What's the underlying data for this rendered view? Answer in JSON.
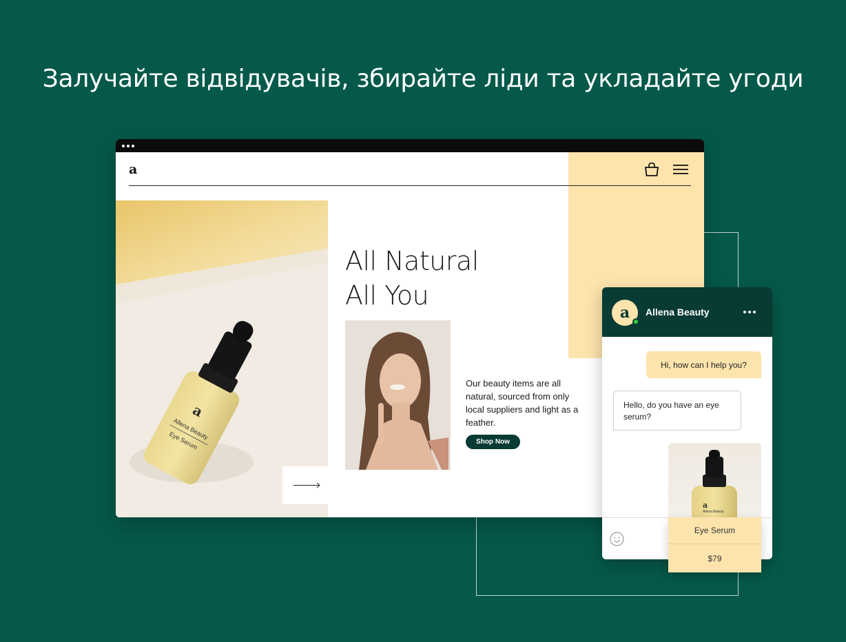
{
  "headline": "Залучайте відвідувачів, збирайте ліди та укладайте угоди",
  "colors": {
    "background": "#05594a",
    "accent_yellow": "#fde4ad",
    "dark_green": "#083b33",
    "online": "#2ecc40"
  },
  "site": {
    "logo": "a",
    "icons": [
      "cart-icon",
      "menu-icon",
      "arrow-right-icon"
    ],
    "hero": {
      "title_line1": "All Natural",
      "title_line2": "All You",
      "description": "Our beauty items are all natural, sourced from only local suppliers and light as a feather.",
      "cta": "Shop Now"
    },
    "product_label": {
      "logo": "a",
      "brand": "Allena Beauty",
      "name": "Eye Serum"
    }
  },
  "chat": {
    "avatar_letter": "a",
    "title": "Allena Beauty",
    "messages": [
      {
        "from": "agent",
        "text": "Hi, how can I help you?"
      },
      {
        "from": "visitor",
        "text": "Hello, do you have an eye serum?"
      }
    ],
    "product": {
      "label_logo": "a",
      "label_brand": "Allena Beauty",
      "name": "Eye Serum",
      "price": "$79"
    },
    "icons": [
      "more-icon",
      "emoji-icon"
    ]
  }
}
